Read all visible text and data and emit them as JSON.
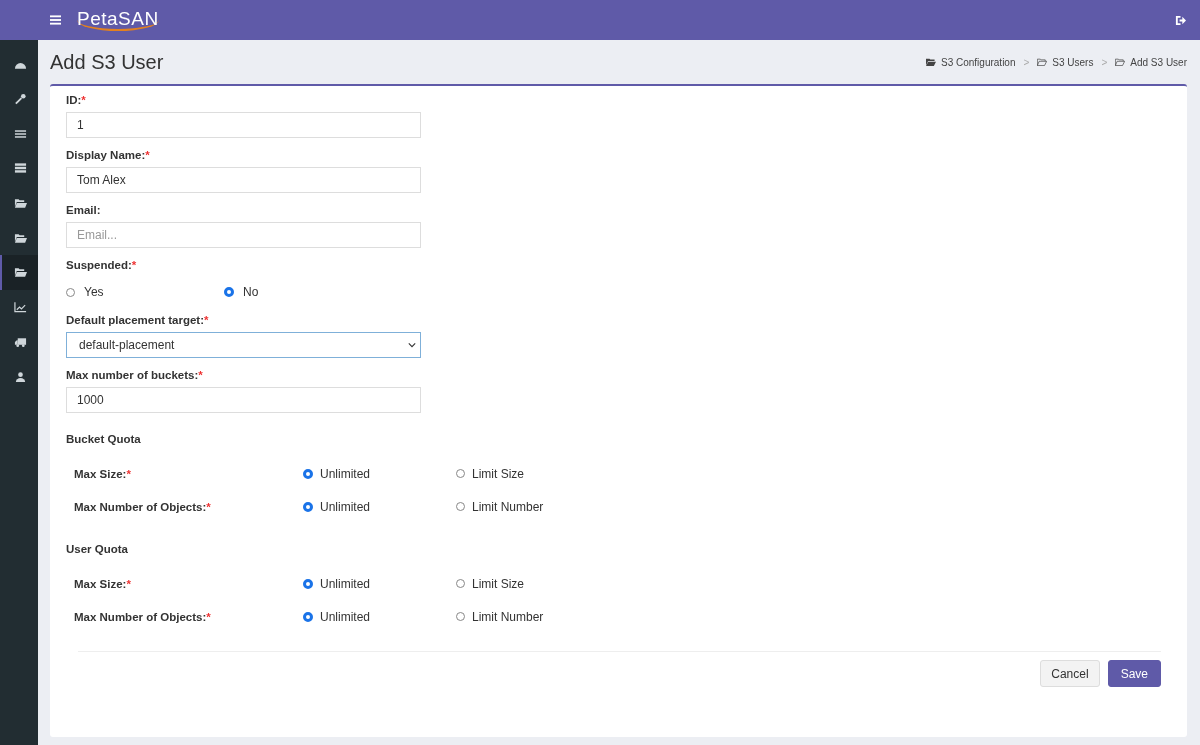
{
  "topbar": {
    "logo": "PetaSAN"
  },
  "sidebar": {
    "items": [
      {
        "kind": "dashboard",
        "selected": false
      },
      {
        "kind": "wrench",
        "selected": false
      },
      {
        "kind": "list",
        "selected": false
      },
      {
        "kind": "servers",
        "selected": false
      },
      {
        "kind": "folder",
        "selected": false
      },
      {
        "kind": "folder",
        "selected": false
      },
      {
        "kind": "folder",
        "selected": true
      },
      {
        "kind": "chart",
        "selected": false
      },
      {
        "kind": "truck",
        "selected": false
      },
      {
        "kind": "user",
        "selected": false
      }
    ]
  },
  "page": {
    "title": "Add S3 User"
  },
  "breadcrumb": [
    {
      "label": "S3 Configuration",
      "kind": "folder-filled"
    },
    {
      "label": "S3 Users",
      "kind": "folder-outline",
      "separator": ">"
    },
    {
      "label": "Add S3 User",
      "kind": "folder-outline",
      "separator": ">"
    }
  ],
  "fields": [
    {
      "kind": "text",
      "label": "ID:",
      "mark": "*",
      "value": "1"
    },
    {
      "kind": "text",
      "label": "Display Name:",
      "mark": "*",
      "value": "Tom Alex"
    },
    {
      "kind": "text",
      "label": "Email:",
      "placeholder": "Email..."
    },
    {
      "kind": "radio",
      "label": "Suspended:",
      "mark": "*",
      "options": [
        {
          "label": "Yes",
          "selected": false
        },
        {
          "label": "No",
          "selected": true
        }
      ]
    },
    {
      "kind": "select",
      "label": "Default placement target:",
      "mark": "*",
      "value": "default-placement"
    },
    {
      "kind": "text",
      "label": "Max number of buckets:",
      "mark": "*",
      "value": "1000"
    }
  ],
  "quotas": [
    {
      "title": "Bucket Quota",
      "rows": [
        {
          "label": "Max Size:",
          "mark": "*",
          "options": [
            {
              "label": "Unlimited",
              "selected": true
            },
            {
              "label": "Limit Size",
              "selected": false
            }
          ]
        },
        {
          "label": "Max Number of Objects:",
          "mark": "*",
          "options": [
            {
              "label": "Unlimited",
              "selected": true
            },
            {
              "label": "Limit Number",
              "selected": false
            }
          ]
        }
      ]
    },
    {
      "title": "User Quota",
      "rows": [
        {
          "label": "Max Size:",
          "mark": "*",
          "options": [
            {
              "label": "Unlimited",
              "selected": true
            },
            {
              "label": "Limit Size",
              "selected": false
            }
          ]
        },
        {
          "label": "Max Number of Objects:",
          "mark": "*",
          "options": [
            {
              "label": "Unlimited",
              "selected": true
            },
            {
              "label": "Limit Number",
              "selected": false
            }
          ]
        }
      ]
    }
  ],
  "buttons": [
    {
      "label": "Cancel",
      "kind": "secondary"
    },
    {
      "label": "Save",
      "kind": "primary"
    }
  ]
}
